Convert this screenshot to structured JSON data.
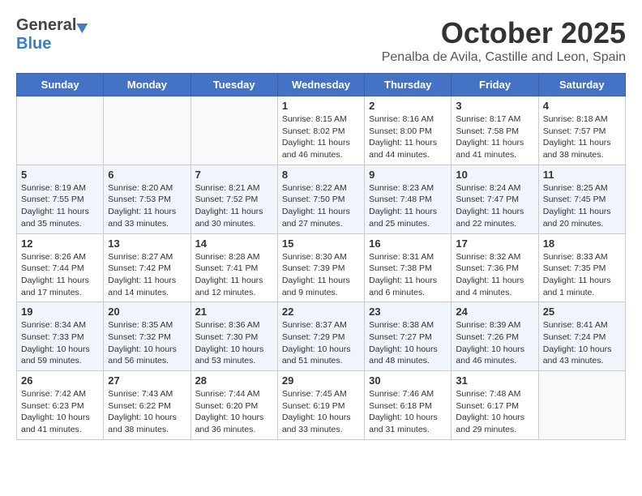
{
  "logo": {
    "general": "General",
    "blue": "Blue"
  },
  "title": {
    "month": "October 2025",
    "location": "Penalba de Avila, Castille and Leon, Spain"
  },
  "weekdays": [
    "Sunday",
    "Monday",
    "Tuesday",
    "Wednesday",
    "Thursday",
    "Friday",
    "Saturday"
  ],
  "weeks": [
    [
      {
        "day": "",
        "info": ""
      },
      {
        "day": "",
        "info": ""
      },
      {
        "day": "",
        "info": ""
      },
      {
        "day": "1",
        "info": "Sunrise: 8:15 AM\nSunset: 8:02 PM\nDaylight: 11 hours and 46 minutes."
      },
      {
        "day": "2",
        "info": "Sunrise: 8:16 AM\nSunset: 8:00 PM\nDaylight: 11 hours and 44 minutes."
      },
      {
        "day": "3",
        "info": "Sunrise: 8:17 AM\nSunset: 7:58 PM\nDaylight: 11 hours and 41 minutes."
      },
      {
        "day": "4",
        "info": "Sunrise: 8:18 AM\nSunset: 7:57 PM\nDaylight: 11 hours and 38 minutes."
      }
    ],
    [
      {
        "day": "5",
        "info": "Sunrise: 8:19 AM\nSunset: 7:55 PM\nDaylight: 11 hours and 35 minutes."
      },
      {
        "day": "6",
        "info": "Sunrise: 8:20 AM\nSunset: 7:53 PM\nDaylight: 11 hours and 33 minutes."
      },
      {
        "day": "7",
        "info": "Sunrise: 8:21 AM\nSunset: 7:52 PM\nDaylight: 11 hours and 30 minutes."
      },
      {
        "day": "8",
        "info": "Sunrise: 8:22 AM\nSunset: 7:50 PM\nDaylight: 11 hours and 27 minutes."
      },
      {
        "day": "9",
        "info": "Sunrise: 8:23 AM\nSunset: 7:48 PM\nDaylight: 11 hours and 25 minutes."
      },
      {
        "day": "10",
        "info": "Sunrise: 8:24 AM\nSunset: 7:47 PM\nDaylight: 11 hours and 22 minutes."
      },
      {
        "day": "11",
        "info": "Sunrise: 8:25 AM\nSunset: 7:45 PM\nDaylight: 11 hours and 20 minutes."
      }
    ],
    [
      {
        "day": "12",
        "info": "Sunrise: 8:26 AM\nSunset: 7:44 PM\nDaylight: 11 hours and 17 minutes."
      },
      {
        "day": "13",
        "info": "Sunrise: 8:27 AM\nSunset: 7:42 PM\nDaylight: 11 hours and 14 minutes."
      },
      {
        "day": "14",
        "info": "Sunrise: 8:28 AM\nSunset: 7:41 PM\nDaylight: 11 hours and 12 minutes."
      },
      {
        "day": "15",
        "info": "Sunrise: 8:30 AM\nSunset: 7:39 PM\nDaylight: 11 hours and 9 minutes."
      },
      {
        "day": "16",
        "info": "Sunrise: 8:31 AM\nSunset: 7:38 PM\nDaylight: 11 hours and 6 minutes."
      },
      {
        "day": "17",
        "info": "Sunrise: 8:32 AM\nSunset: 7:36 PM\nDaylight: 11 hours and 4 minutes."
      },
      {
        "day": "18",
        "info": "Sunrise: 8:33 AM\nSunset: 7:35 PM\nDaylight: 11 hours and 1 minute."
      }
    ],
    [
      {
        "day": "19",
        "info": "Sunrise: 8:34 AM\nSunset: 7:33 PM\nDaylight: 10 hours and 59 minutes."
      },
      {
        "day": "20",
        "info": "Sunrise: 8:35 AM\nSunset: 7:32 PM\nDaylight: 10 hours and 56 minutes."
      },
      {
        "day": "21",
        "info": "Sunrise: 8:36 AM\nSunset: 7:30 PM\nDaylight: 10 hours and 53 minutes."
      },
      {
        "day": "22",
        "info": "Sunrise: 8:37 AM\nSunset: 7:29 PM\nDaylight: 10 hours and 51 minutes."
      },
      {
        "day": "23",
        "info": "Sunrise: 8:38 AM\nSunset: 7:27 PM\nDaylight: 10 hours and 48 minutes."
      },
      {
        "day": "24",
        "info": "Sunrise: 8:39 AM\nSunset: 7:26 PM\nDaylight: 10 hours and 46 minutes."
      },
      {
        "day": "25",
        "info": "Sunrise: 8:41 AM\nSunset: 7:24 PM\nDaylight: 10 hours and 43 minutes."
      }
    ],
    [
      {
        "day": "26",
        "info": "Sunrise: 7:42 AM\nSunset: 6:23 PM\nDaylight: 10 hours and 41 minutes."
      },
      {
        "day": "27",
        "info": "Sunrise: 7:43 AM\nSunset: 6:22 PM\nDaylight: 10 hours and 38 minutes."
      },
      {
        "day": "28",
        "info": "Sunrise: 7:44 AM\nSunset: 6:20 PM\nDaylight: 10 hours and 36 minutes."
      },
      {
        "day": "29",
        "info": "Sunrise: 7:45 AM\nSunset: 6:19 PM\nDaylight: 10 hours and 33 minutes."
      },
      {
        "day": "30",
        "info": "Sunrise: 7:46 AM\nSunset: 6:18 PM\nDaylight: 10 hours and 31 minutes."
      },
      {
        "day": "31",
        "info": "Sunrise: 7:48 AM\nSunset: 6:17 PM\nDaylight: 10 hours and 29 minutes."
      },
      {
        "day": "",
        "info": ""
      }
    ]
  ]
}
